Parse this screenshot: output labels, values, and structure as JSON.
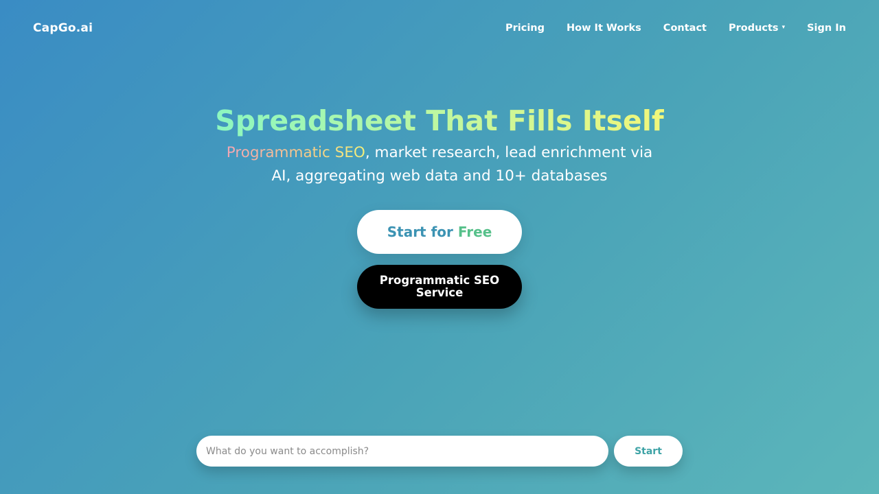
{
  "brand": {
    "name": "CapGo.ai"
  },
  "nav": {
    "items": [
      {
        "label": "Pricing"
      },
      {
        "label": "How It Works"
      },
      {
        "label": "Contact"
      },
      {
        "label": "Products",
        "caret": "▾"
      },
      {
        "label": "Sign In"
      }
    ]
  },
  "hero": {
    "title": "Spreadsheet That Fills Itself",
    "subtitle_highlight": "Programmatic SEO",
    "subtitle_rest": ", market research, lead enrichment via AI, aggregating web data and 10+ databases"
  },
  "cta": {
    "start_part1": "Start for",
    "start_part2": "Free",
    "seo_service": "Programmatic SEO Service"
  },
  "search": {
    "placeholder": "What do you want to accomplish?",
    "value": "",
    "button": "Start"
  },
  "colors": {
    "bg_start": "#3a8cc4",
    "bg_end": "#5cb6ba",
    "title_gradient": [
      "#8cf7c0",
      "#f2f77a"
    ],
    "cta_blue": "#3c93b3",
    "cta_green": "#56c08a",
    "search_button_text": "#3ea3a6"
  }
}
